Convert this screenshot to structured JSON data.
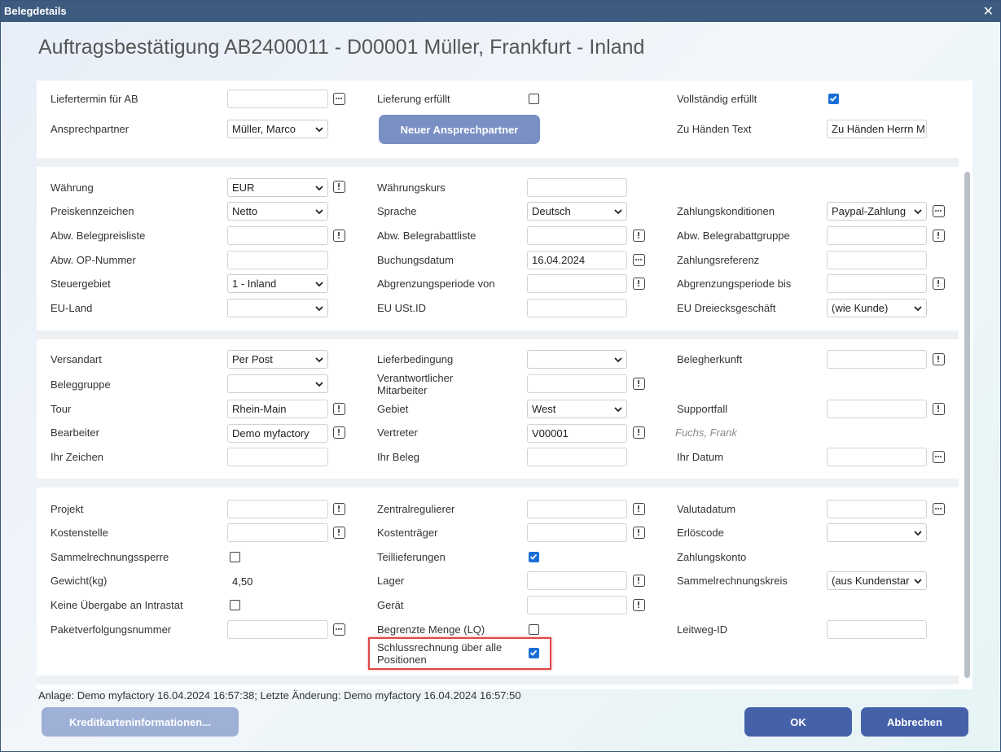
{
  "window": {
    "title": "Belegdetails",
    "heading": "Auftragsbestätigung AB2400011 - D00001 Müller, Frankfurt - Inland"
  },
  "section1": {
    "liefertermin_label": "Liefertermin für AB",
    "liefertermin_value": "",
    "lieferung_erfuellt_label": "Lieferung erfüllt",
    "lieferung_erfuellt_checked": false,
    "vollstaendig_label": "Vollständig erfüllt",
    "vollstaendig_checked": true,
    "ansprechpartner_label": "Ansprechpartner",
    "ansprechpartner_value": "Müller, Marco",
    "neuer_ansprechpartner_button": "Neuer Ansprechpartner",
    "zu_haenden_label": "Zu Händen Text",
    "zu_haenden_value": "Zu Händen Herrn M"
  },
  "section2": {
    "waehrung_label": "Währung",
    "waehrung_value": "EUR",
    "waehrungskurs_label": "Währungskurs",
    "waehrungskurs_value": "",
    "preiskennzeichen_label": "Preiskennzeichen",
    "preiskennzeichen_value": "Netto",
    "sprache_label": "Sprache",
    "sprache_value": "Deutsch",
    "zahlungskonditionen_label": "Zahlungskonditionen",
    "zahlungskonditionen_value": "Paypal-Zahlung",
    "abw_belegpreisliste_label": "Abw. Belegpreisliste",
    "abw_belegrabattliste_label": "Abw. Belegrabattliste",
    "abw_belegrabattgruppe_label": "Abw. Belegrabattgruppe",
    "abw_op_nummer_label": "Abw. OP-Nummer",
    "buchungsdatum_label": "Buchungsdatum",
    "buchungsdatum_value": "16.04.2024",
    "zahlungsreferenz_label": "Zahlungsreferenz",
    "steuergebiet_label": "Steuergebiet",
    "steuergebiet_value": "1 - Inland",
    "abgrenzung_von_label": "Abgrenzungsperiode von",
    "abgrenzung_bis_label": "Abgrenzungsperiode bis",
    "eu_land_label": "EU-Land",
    "eu_land_value": "",
    "eu_ustid_label": "EU USt.ID",
    "eu_dreiecks_label": "EU Dreiecksgeschäft",
    "eu_dreiecks_value": "(wie Kunde)"
  },
  "section3": {
    "versandart_label": "Versandart",
    "versandart_value": "Per Post",
    "lieferbedingung_label": "Lieferbedingung",
    "lieferbedingung_value": "",
    "belegherkunft_label": "Belegherkunft",
    "beleggruppe_label": "Beleggruppe",
    "beleggruppe_value": "",
    "verantwortlicher_label": "Verantwortlicher Mitarbeiter",
    "tour_label": "Tour",
    "tour_value": "Rhein-Main",
    "gebiet_label": "Gebiet",
    "gebiet_value": "West",
    "supportfall_label": "Supportfall",
    "bearbeiter_label": "Bearbeiter",
    "bearbeiter_value": "Demo myfactory",
    "vertreter_label": "Vertreter",
    "vertreter_value": "V00001",
    "vertreter_name": "Fuchs, Frank",
    "ihr_zeichen_label": "Ihr Zeichen",
    "ihr_beleg_label": "Ihr Beleg",
    "ihr_datum_label": "Ihr Datum"
  },
  "section4": {
    "projekt_label": "Projekt",
    "zentralregulierer_label": "Zentralregulierer",
    "valutadatum_label": "Valutadatum",
    "kostenstelle_label": "Kostenstelle",
    "kostentraeger_label": "Kostenträger",
    "erloescode_label": "Erlöscode",
    "erloescode_value": "",
    "sammelrechnungssperre_label": "Sammelrechnungssperre",
    "sammelrechnungssperre_checked": false,
    "teillieferungen_label": "Teillieferungen",
    "teillieferungen_checked": true,
    "zahlungskonto_label": "Zahlungskonto",
    "gewicht_label": "Gewicht(kg)",
    "gewicht_value": "4,50",
    "lager_label": "Lager",
    "sammelrechnungskreis_label": "Sammelrechnungskreis",
    "sammelrechnungskreis_value": "(aus Kundenstar",
    "keine_uebergabe_label": "Keine Übergabe an Intrastat",
    "keine_uebergabe_checked": false,
    "geraet_label": "Gerät",
    "paketverfolgung_label": "Paketverfolgungsnummer",
    "begrenzte_menge_label": "Begrenzte Menge (LQ)",
    "begrenzte_menge_checked": false,
    "leitweg_label": "Leitweg-ID",
    "schlussrechnung_label": "Schlussrechnung über alle Positionen",
    "schlussrechnung_checked": true
  },
  "footer": {
    "audit_text": "Anlage: Demo myfactory 16.04.2024 16:57:38; Letzte Änderung: Demo myfactory 16.04.2024 16:57:50",
    "kreditkarten_button": "Kreditkarteninformationen...",
    "ok_button": "OK",
    "abbrechen_button": "Abbrechen"
  },
  "colors": {
    "titlebar": "#3d5a7f",
    "primary_button": "#4561a9",
    "checkbox_checked": "#1a6fd6",
    "highlight": "#e04848"
  }
}
